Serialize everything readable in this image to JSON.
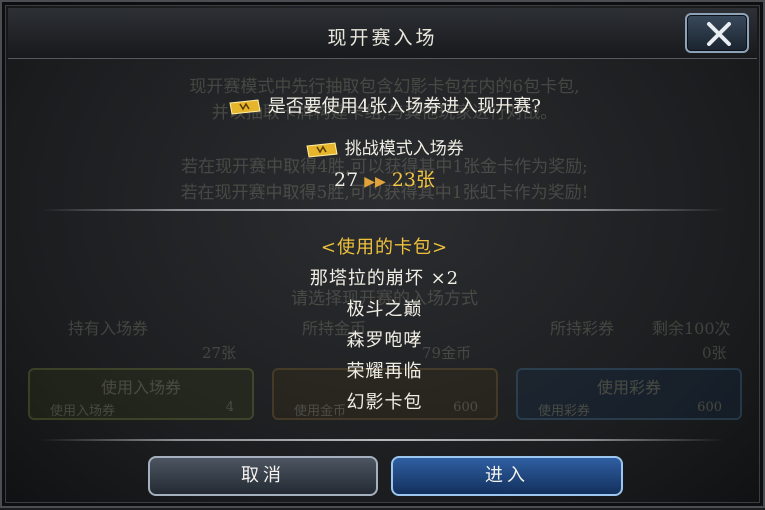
{
  "dialog": {
    "title": "现开赛入场",
    "question": "是否要使用4张入场券进入现开赛?",
    "ticket_type": "挑战模式入场券",
    "count_from": "27",
    "count_to": "23张",
    "packs_header": "<使用的卡包>",
    "packs": [
      "那塔拉的崩坏 ×2",
      "极斗之巅",
      "森罗咆哮",
      "荣耀再临",
      "幻影卡包"
    ],
    "cancel_label": "取消",
    "enter_label": "进入"
  },
  "background": {
    "line1": "现开赛模式中先行抽取包含幻影卡包在内的6包卡包,",
    "line2": "并以抽取卡牌构建卡组,与其他玩家进行对战。",
    "line3": "若在现开赛中取得4胜,可以获得其中1张金卡作为奖励;",
    "line4": "若在现开赛中取得5胜,可以获得其中1张虹卡作为奖励!",
    "choose_method": "请选择现开赛的入场方式",
    "ticket_label": "持有入场券",
    "ticket_count": "27张",
    "coin_label": "所持金币",
    "coin_count": "79金币",
    "rainbow_label": "所持彩券",
    "rainbow_remaining": "剩余100次",
    "rainbow_count": "0张",
    "use_ticket_btn": "使用入场券",
    "use_ticket_sub": "使用入场券",
    "use_ticket_cost": "4",
    "use_coin_sub": "使用金币",
    "use_coin_cost": "600",
    "use_rainbow_btn": "使用彩券",
    "use_rainbow_sub": "使用彩券",
    "use_rainbow_cost": "600"
  },
  "colors": {
    "accent_gold": "#f3c542",
    "enter_blue": "#2f5fa3"
  }
}
